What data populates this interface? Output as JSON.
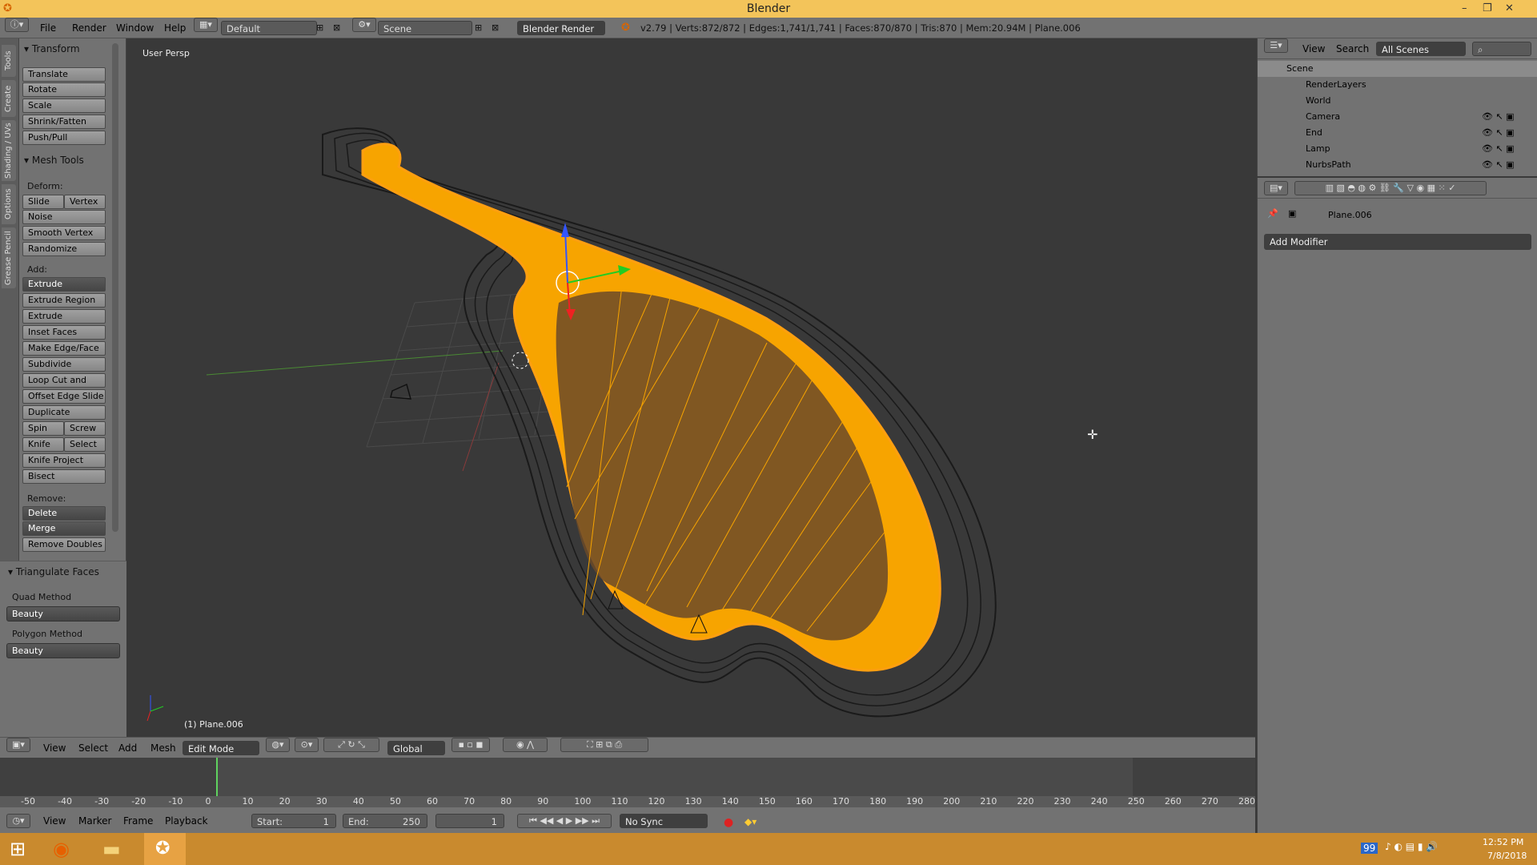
{
  "window": {
    "title": "Blender"
  },
  "infobar": {
    "menus": [
      "File",
      "Render",
      "Window",
      "Help"
    ],
    "layout": "Default",
    "scene": "Scene",
    "engine": "Blender Render",
    "stats": "v2.79 | Verts:872/872 | Edges:1,741/1,741 | Faces:870/870 | Tris:870 | Mem:20.94M | Plane.006"
  },
  "tabs": [
    "Tools",
    "Create",
    "Shading / UVs",
    "Options",
    "Grease Pencil"
  ],
  "shelf": {
    "transform_title": "Transform",
    "transform": [
      "Translate",
      "Rotate",
      "Scale",
      "Shrink/Fatten",
      "Push/Pull"
    ],
    "mesh_title": "Mesh Tools",
    "deform_label": "Deform:",
    "slide_edge": "Slide Ed",
    "vertex": "Vertex",
    "deform": [
      "Noise",
      "Smooth Vertex",
      "Randomize"
    ],
    "add_label": "Add:",
    "extrude": "Extrude",
    "add": [
      "Extrude Region",
      "Extrude Individual",
      "Inset Faces",
      "Make Edge/Face",
      "Subdivide",
      "Loop Cut and Slide",
      "Offset Edge Slide",
      "Duplicate"
    ],
    "spin": "Spin",
    "screw": "Screw",
    "knife": "Knife",
    "select": "Select",
    "add2": [
      "Knife Project",
      "Bisect"
    ],
    "remove_label": "Remove:",
    "delete": "Delete",
    "merge": "Merge",
    "remove_doubles": "Remove Doubles",
    "tri_title": "Triangulate Faces",
    "quad_label": "Quad Method",
    "quad_value": "Beauty",
    "poly_label": "Polygon Method",
    "poly_value": "Beauty"
  },
  "viewport": {
    "persp": "User Persp",
    "object": "(1) Plane.006"
  },
  "view3d_header": {
    "menus": [
      "View",
      "Select",
      "Add",
      "Mesh"
    ],
    "mode": "Edit Mode",
    "orientation": "Global"
  },
  "timeline": {
    "ticks": [
      "-50",
      "-40",
      "-30",
      "-20",
      "-10",
      "0",
      "10",
      "20",
      "30",
      "40",
      "50",
      "60",
      "70",
      "80",
      "90",
      "100",
      "110",
      "120",
      "130",
      "140",
      "150",
      "160",
      "170",
      "180",
      "190",
      "200",
      "210",
      "220",
      "230",
      "240",
      "250",
      "260",
      "270",
      "280"
    ]
  },
  "timeline_header": {
    "menus": [
      "View",
      "Marker",
      "Frame",
      "Playback"
    ],
    "start_label": "Start:",
    "start": "1",
    "end_label": "End:",
    "end": "250",
    "current": "1",
    "sync": "No Sync"
  },
  "outliner": {
    "menus": [
      "View",
      "Search"
    ],
    "filter": "All Scenes",
    "items": [
      "Scene",
      "RenderLayers",
      "World",
      "Camera",
      "End",
      "Lamp",
      "NurbsPath"
    ]
  },
  "properties": {
    "object": "Plane.006",
    "add_modifier": "Add Modifier"
  },
  "taskbar": {
    "time": "12:52 PM",
    "date": "7/8/2018",
    "badge": "99"
  },
  "colors": {
    "accent": "#f7a400",
    "select_orange": "#ffa219"
  }
}
